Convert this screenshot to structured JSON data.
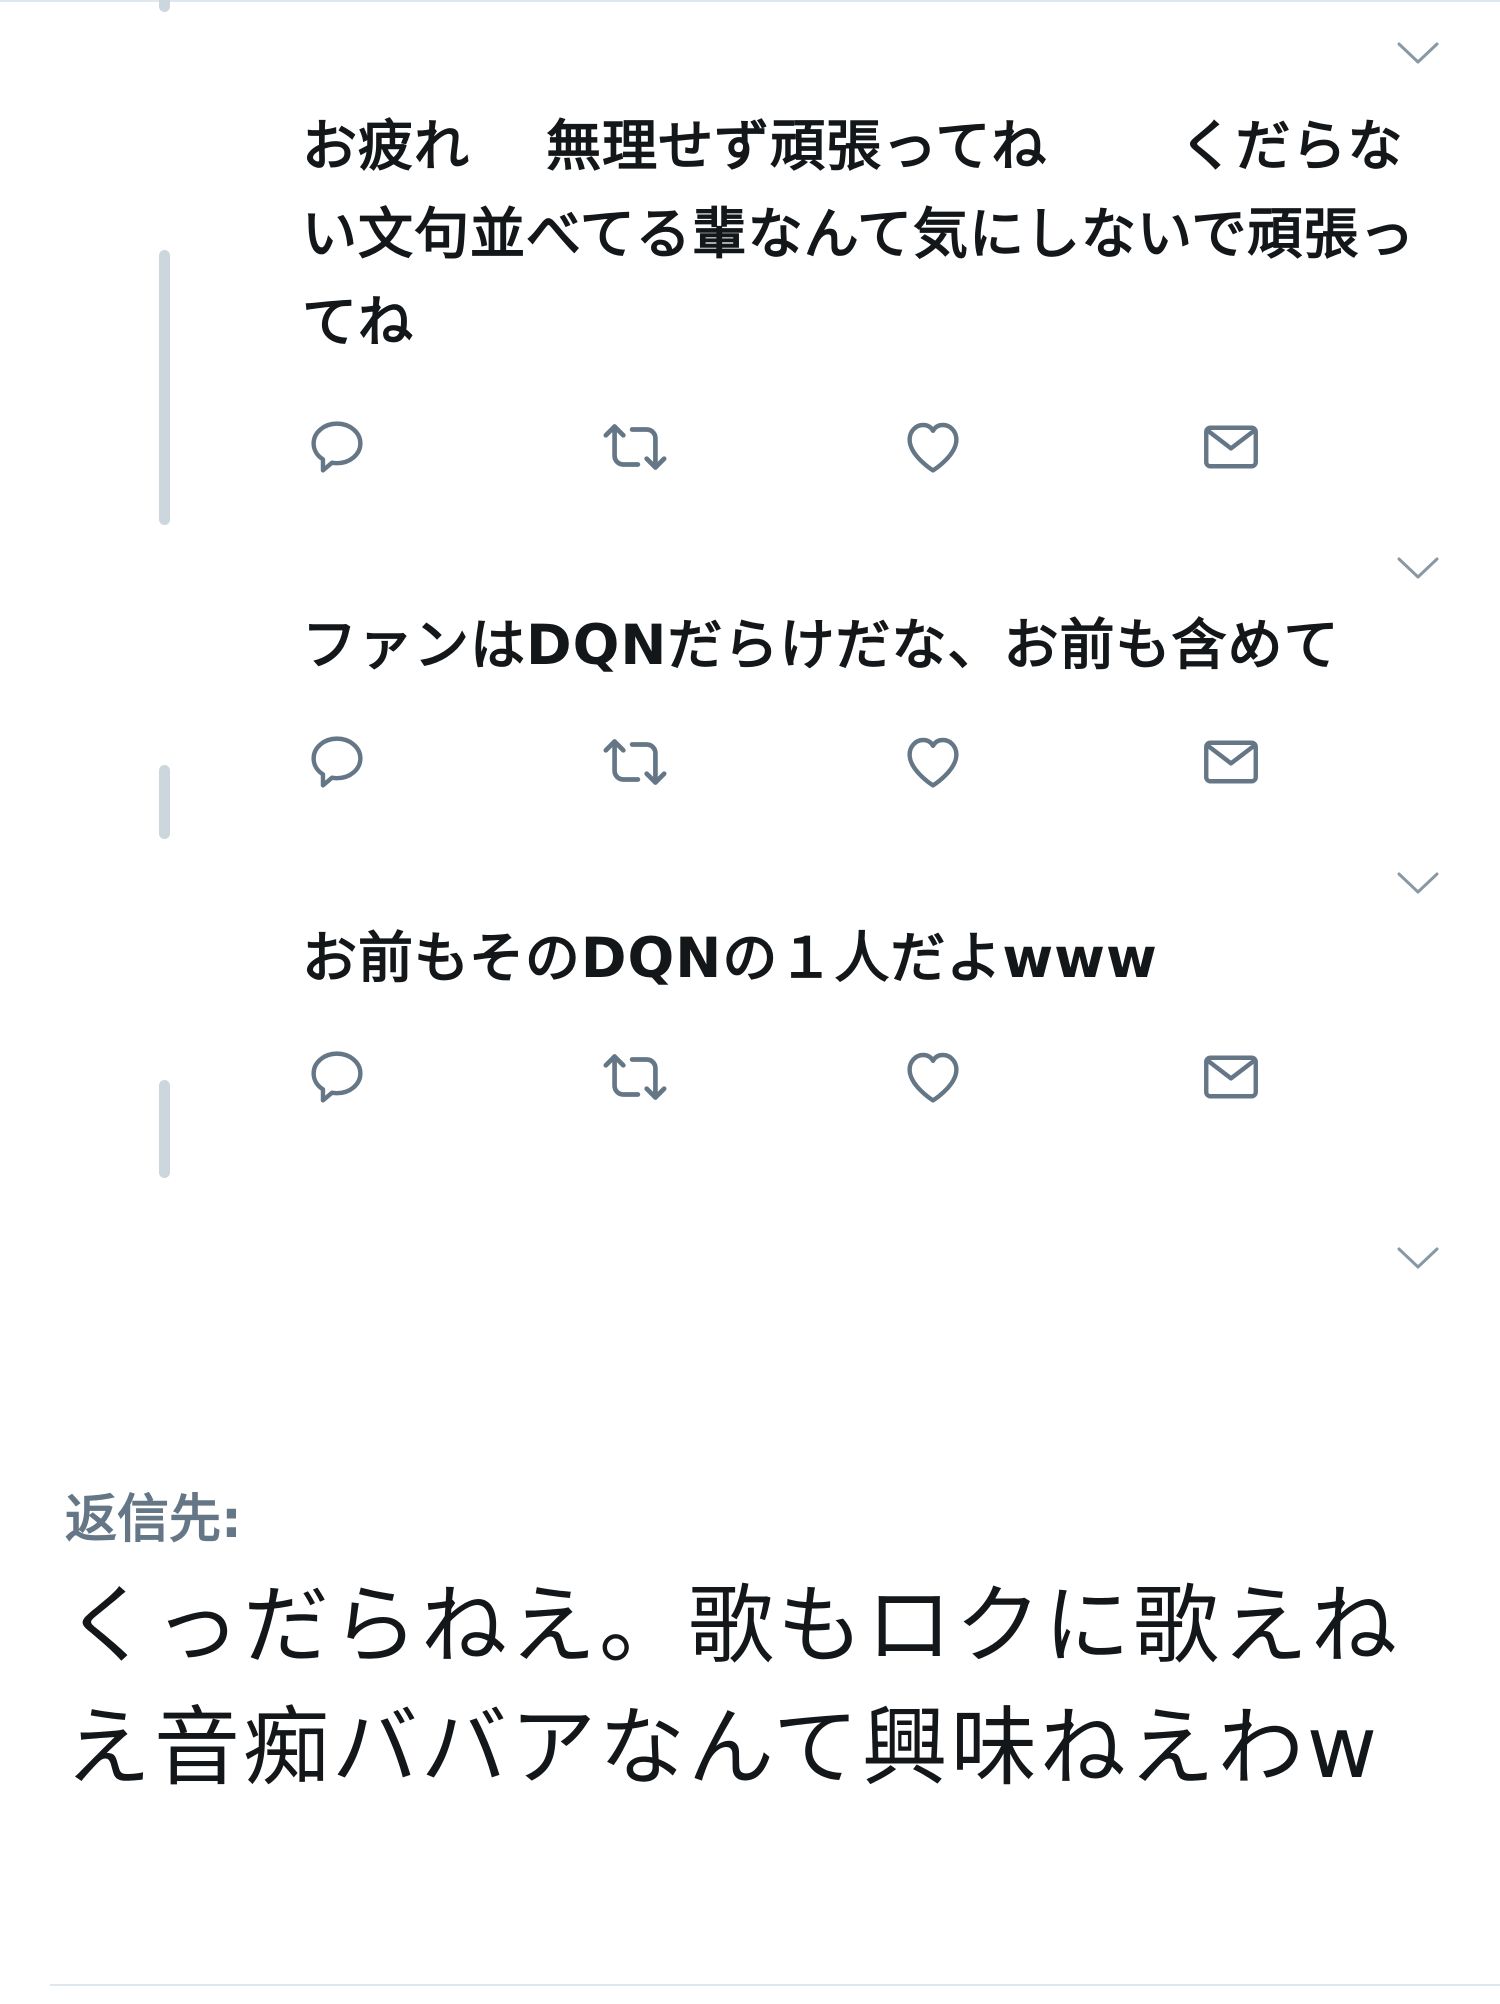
{
  "colors": {
    "text": "#14171a",
    "secondary": "#657786",
    "thread_line": "#ccd6dd",
    "icon": "#657786",
    "divider": "#e1e8ed"
  },
  "tweets": [
    {
      "text": "お疲れ　 無理せず頑張ってね　　 くだらない文句並べてる輩なんて気にしないで頑張ってね",
      "actions": [
        "reply-icon",
        "retweet-icon",
        "like-icon",
        "dm-icon"
      ]
    },
    {
      "text": "ファンはDQNだらけだな、お前も含めて",
      "actions": [
        "reply-icon",
        "retweet-icon",
        "like-icon",
        "dm-icon"
      ]
    },
    {
      "text": "お前もそのDQNの１人だよwww",
      "actions": [
        "reply-icon",
        "retweet-icon",
        "like-icon",
        "dm-icon"
      ]
    }
  ],
  "caret_icon": "chevron-down-icon",
  "main_tweet": {
    "reply_label": "返信先:",
    "text": "くっだらねえ。歌もロクに歌えねえ音痴ババアなんて興味ねえわw"
  }
}
